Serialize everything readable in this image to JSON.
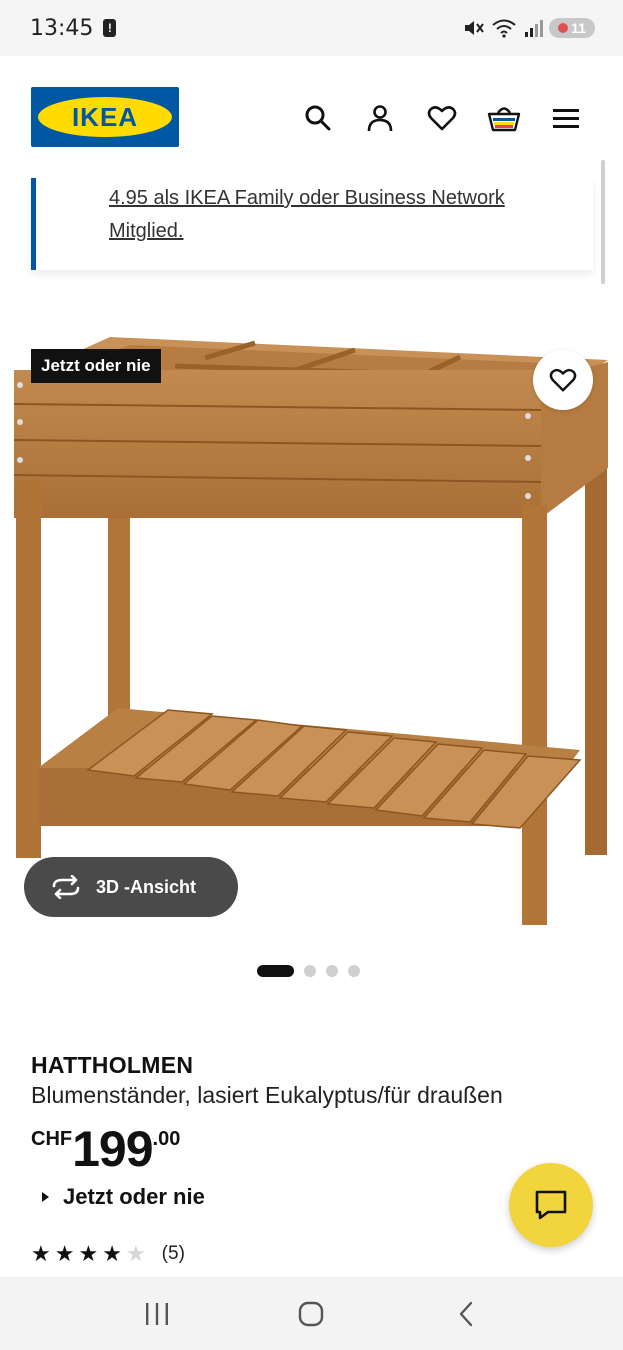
{
  "status_bar": {
    "time": "13:45",
    "alert_glyph": "!",
    "battery_level": "11"
  },
  "header": {
    "logo_text": "IKEA",
    "icons": [
      "search-icon",
      "account-icon",
      "heart-icon",
      "basket-icon",
      "menu-icon"
    ]
  },
  "promo": {
    "text": "4.95 als IKEA Family oder Business Network Mitglied."
  },
  "image": {
    "badge": "Jetzt oder nie",
    "view3d_label": "3D -Ansicht",
    "carousel": {
      "total": 4,
      "active": 1
    }
  },
  "product": {
    "name": "HATTHOLMEN",
    "description": "Blumenständer, lasiert Eukalyptus/für draußen",
    "price_currency": "CHF",
    "price_main": "199",
    "price_decimal": ".00",
    "promo_label": "Jetzt oder nie",
    "rating_stars": 4,
    "rating_max": 5,
    "rating_count": "(5)"
  },
  "colors": {
    "ikea_blue": "#0058a3",
    "ikea_yellow": "#ffdb00",
    "chat_yellow": "#f2d53c",
    "wood": "#b57a3f"
  },
  "navigation": {
    "buttons": [
      "recent-apps-icon",
      "home-icon",
      "back-icon"
    ]
  }
}
